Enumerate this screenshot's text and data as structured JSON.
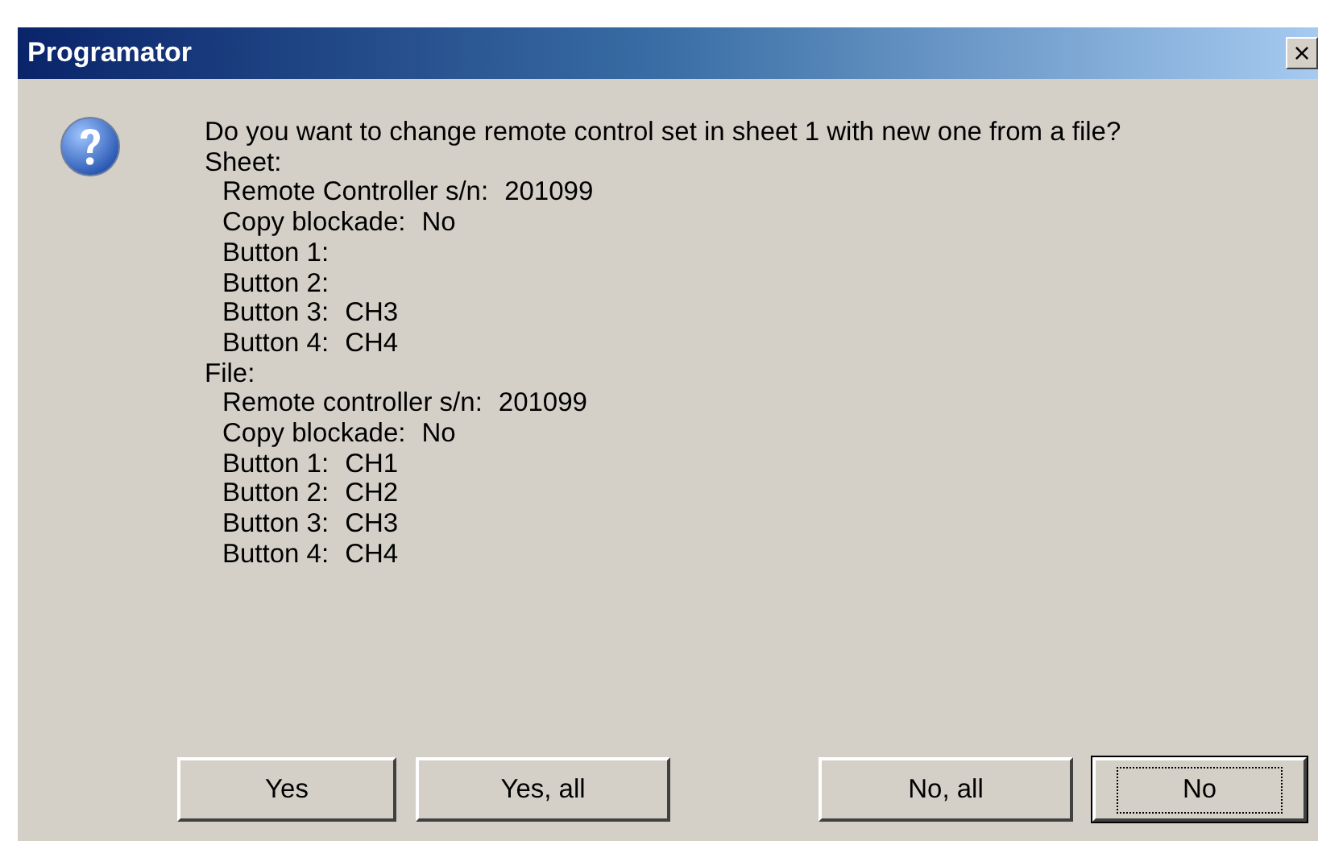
{
  "window": {
    "title": "Programator",
    "close": "×"
  },
  "message": "Do you want to change remote control set in sheet 1 with new one from a file?",
  "sections": [
    {
      "heading": "Sheet:",
      "fields": [
        {
          "label": "Remote Controller s/n:",
          "value": "201099"
        },
        {
          "label": "Copy blockade:",
          "value": "No"
        },
        {
          "label": "Button 1:"
        },
        {
          "label": "Button 2:"
        },
        {
          "label": "Button 3:",
          "value": "CH3"
        },
        {
          "label": "Button 4:",
          "value": "CH4"
        }
      ]
    },
    {
      "heading": "File:",
      "fields": [
        {
          "label": "Remote controller s/n:",
          "value": "201099"
        },
        {
          "label": "Copy blockade:",
          "value": "No"
        },
        {
          "label": "Button 1:",
          "value": "CH1"
        },
        {
          "label": "Button 2:",
          "value": "CH2"
        },
        {
          "label": "Button 3:",
          "value": "CH3"
        },
        {
          "label": "Button 4:",
          "value": "CH4"
        }
      ]
    }
  ],
  "buttons": [
    {
      "label": "Yes",
      "default": false
    },
    {
      "label": "Yes, all",
      "default": false
    },
    {
      "label": "No, all",
      "default": false
    },
    {
      "label": "No",
      "default": true
    }
  ]
}
